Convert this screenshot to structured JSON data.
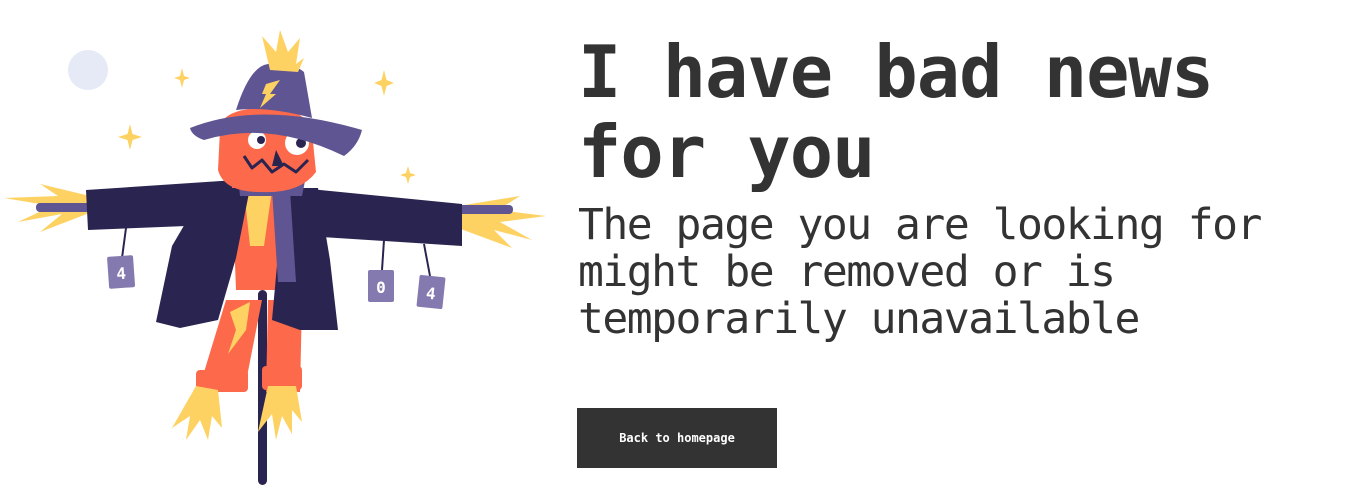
{
  "headline": "I have bad news for you",
  "subtext": "The page you are looking for might be removed or is temporarily unavailable",
  "button": {
    "label": "Back to homepage"
  },
  "illustration": {
    "cans": [
      "4",
      "0",
      "4"
    ]
  },
  "colors": {
    "text": "#333333",
    "button_bg": "#333333",
    "button_text": "#ffffff",
    "hat": "#5f5592",
    "coat": "#2a2450",
    "face": "#fd6a4b",
    "straw": "#fdd263",
    "moon": "#e6e9f6"
  }
}
